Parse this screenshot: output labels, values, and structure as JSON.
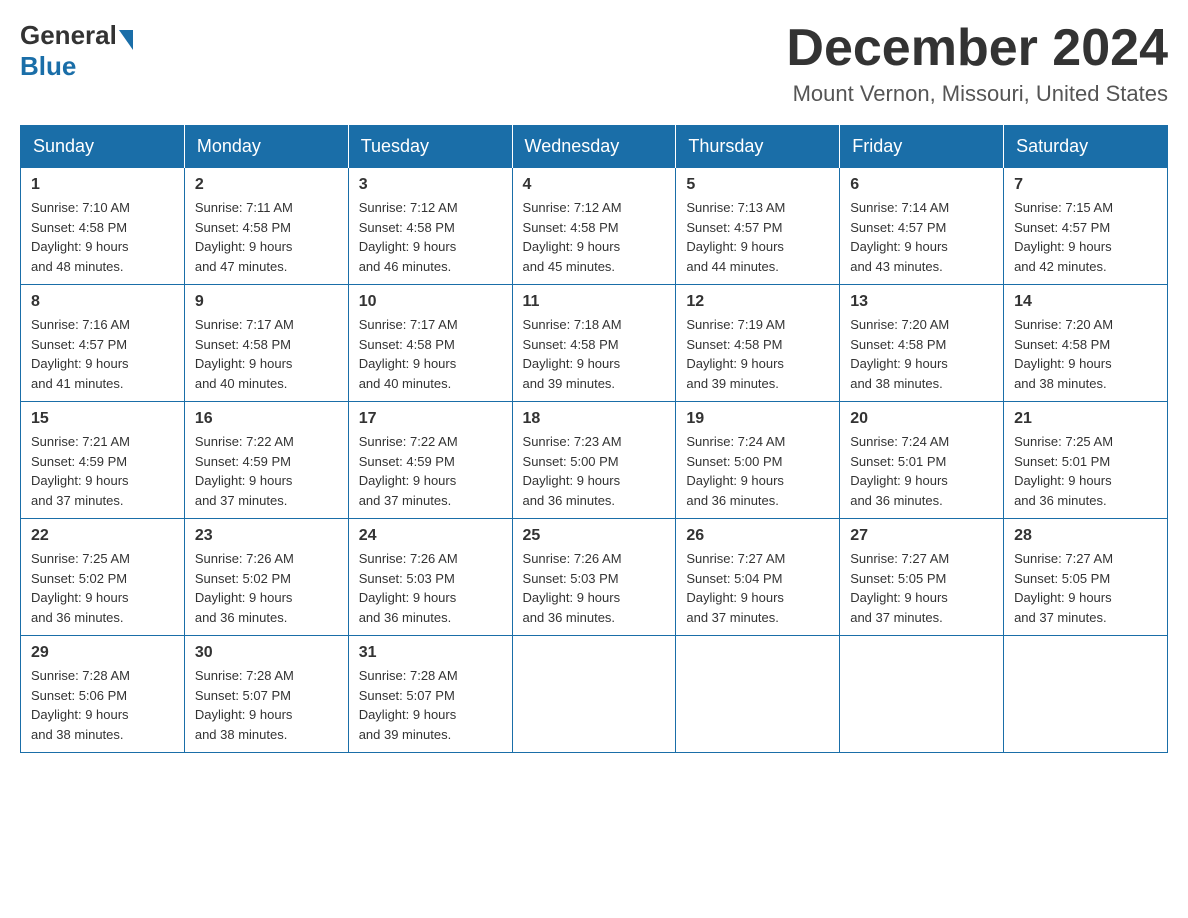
{
  "logo": {
    "general": "General",
    "blue": "Blue"
  },
  "header": {
    "month": "December 2024",
    "location": "Mount Vernon, Missouri, United States"
  },
  "weekdays": [
    "Sunday",
    "Monday",
    "Tuesday",
    "Wednesday",
    "Thursday",
    "Friday",
    "Saturday"
  ],
  "weeks": [
    [
      {
        "day": "1",
        "sunrise": "7:10 AM",
        "sunset": "4:58 PM",
        "daylight": "9 hours and 48 minutes."
      },
      {
        "day": "2",
        "sunrise": "7:11 AM",
        "sunset": "4:58 PM",
        "daylight": "9 hours and 47 minutes."
      },
      {
        "day": "3",
        "sunrise": "7:12 AM",
        "sunset": "4:58 PM",
        "daylight": "9 hours and 46 minutes."
      },
      {
        "day": "4",
        "sunrise": "7:12 AM",
        "sunset": "4:58 PM",
        "daylight": "9 hours and 45 minutes."
      },
      {
        "day": "5",
        "sunrise": "7:13 AM",
        "sunset": "4:57 PM",
        "daylight": "9 hours and 44 minutes."
      },
      {
        "day": "6",
        "sunrise": "7:14 AM",
        "sunset": "4:57 PM",
        "daylight": "9 hours and 43 minutes."
      },
      {
        "day": "7",
        "sunrise": "7:15 AM",
        "sunset": "4:57 PM",
        "daylight": "9 hours and 42 minutes."
      }
    ],
    [
      {
        "day": "8",
        "sunrise": "7:16 AM",
        "sunset": "4:57 PM",
        "daylight": "9 hours and 41 minutes."
      },
      {
        "day": "9",
        "sunrise": "7:17 AM",
        "sunset": "4:58 PM",
        "daylight": "9 hours and 40 minutes."
      },
      {
        "day": "10",
        "sunrise": "7:17 AM",
        "sunset": "4:58 PM",
        "daylight": "9 hours and 40 minutes."
      },
      {
        "day": "11",
        "sunrise": "7:18 AM",
        "sunset": "4:58 PM",
        "daylight": "9 hours and 39 minutes."
      },
      {
        "day": "12",
        "sunrise": "7:19 AM",
        "sunset": "4:58 PM",
        "daylight": "9 hours and 39 minutes."
      },
      {
        "day": "13",
        "sunrise": "7:20 AM",
        "sunset": "4:58 PM",
        "daylight": "9 hours and 38 minutes."
      },
      {
        "day": "14",
        "sunrise": "7:20 AM",
        "sunset": "4:58 PM",
        "daylight": "9 hours and 38 minutes."
      }
    ],
    [
      {
        "day": "15",
        "sunrise": "7:21 AM",
        "sunset": "4:59 PM",
        "daylight": "9 hours and 37 minutes."
      },
      {
        "day": "16",
        "sunrise": "7:22 AM",
        "sunset": "4:59 PM",
        "daylight": "9 hours and 37 minutes."
      },
      {
        "day": "17",
        "sunrise": "7:22 AM",
        "sunset": "4:59 PM",
        "daylight": "9 hours and 37 minutes."
      },
      {
        "day": "18",
        "sunrise": "7:23 AM",
        "sunset": "5:00 PM",
        "daylight": "9 hours and 36 minutes."
      },
      {
        "day": "19",
        "sunrise": "7:24 AM",
        "sunset": "5:00 PM",
        "daylight": "9 hours and 36 minutes."
      },
      {
        "day": "20",
        "sunrise": "7:24 AM",
        "sunset": "5:01 PM",
        "daylight": "9 hours and 36 minutes."
      },
      {
        "day": "21",
        "sunrise": "7:25 AM",
        "sunset": "5:01 PM",
        "daylight": "9 hours and 36 minutes."
      }
    ],
    [
      {
        "day": "22",
        "sunrise": "7:25 AM",
        "sunset": "5:02 PM",
        "daylight": "9 hours and 36 minutes."
      },
      {
        "day": "23",
        "sunrise": "7:26 AM",
        "sunset": "5:02 PM",
        "daylight": "9 hours and 36 minutes."
      },
      {
        "day": "24",
        "sunrise": "7:26 AM",
        "sunset": "5:03 PM",
        "daylight": "9 hours and 36 minutes."
      },
      {
        "day": "25",
        "sunrise": "7:26 AM",
        "sunset": "5:03 PM",
        "daylight": "9 hours and 36 minutes."
      },
      {
        "day": "26",
        "sunrise": "7:27 AM",
        "sunset": "5:04 PM",
        "daylight": "9 hours and 37 minutes."
      },
      {
        "day": "27",
        "sunrise": "7:27 AM",
        "sunset": "5:05 PM",
        "daylight": "9 hours and 37 minutes."
      },
      {
        "day": "28",
        "sunrise": "7:27 AM",
        "sunset": "5:05 PM",
        "daylight": "9 hours and 37 minutes."
      }
    ],
    [
      {
        "day": "29",
        "sunrise": "7:28 AM",
        "sunset": "5:06 PM",
        "daylight": "9 hours and 38 minutes."
      },
      {
        "day": "30",
        "sunrise": "7:28 AM",
        "sunset": "5:07 PM",
        "daylight": "9 hours and 38 minutes."
      },
      {
        "day": "31",
        "sunrise": "7:28 AM",
        "sunset": "5:07 PM",
        "daylight": "9 hours and 39 minutes."
      },
      null,
      null,
      null,
      null
    ]
  ],
  "labels": {
    "sunrise": "Sunrise:",
    "sunset": "Sunset:",
    "daylight": "Daylight:"
  }
}
